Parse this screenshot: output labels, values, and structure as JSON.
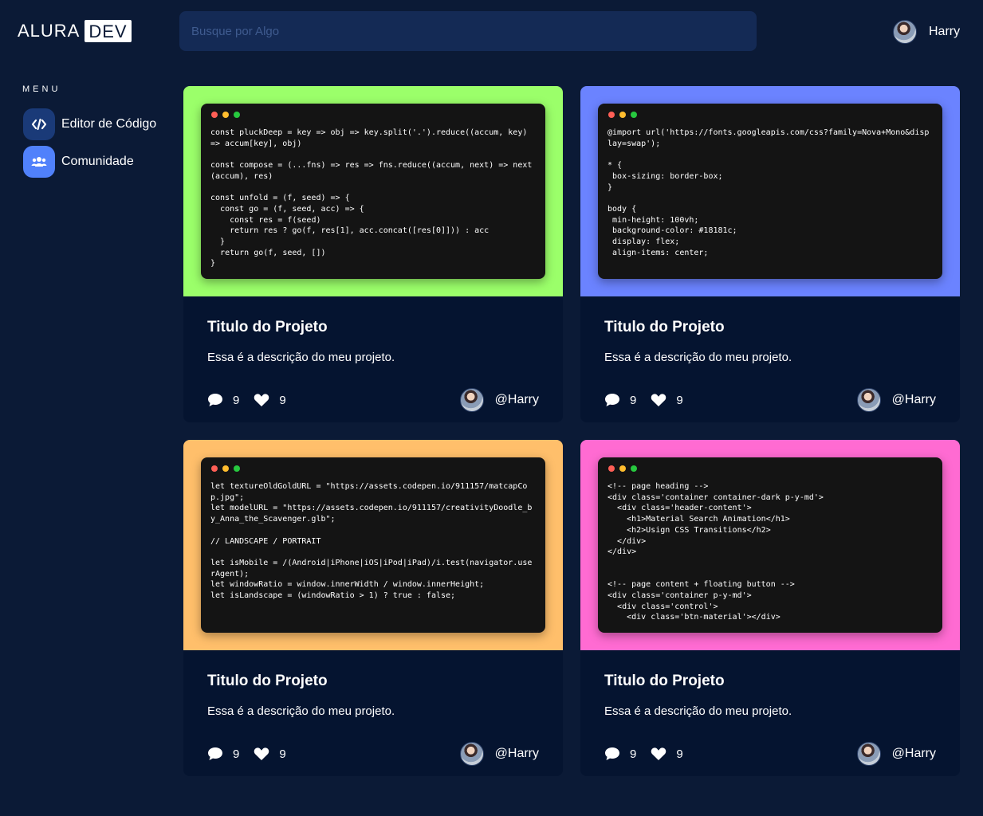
{
  "header": {
    "logo_text": "ALURA",
    "logo_badge": "DEV",
    "search_placeholder": "Busque por Algo",
    "user_name": "Harry"
  },
  "menu": {
    "title": "MENU",
    "items": [
      {
        "label": "Editor de Código",
        "icon": "code-icon"
      },
      {
        "label": "Comunidade",
        "icon": "users-icon"
      }
    ]
  },
  "colors": {
    "background": "#0b1a36",
    "card_green": "#9bff6a",
    "card_blue": "#6b83ff",
    "card_orange": "#ffbf6b",
    "card_pink": "#ff6bd2"
  },
  "cards": [
    {
      "color": "#9bff6a",
      "code": "const pluckDeep = key => obj => key.split('.').reduce((accum, key) => accum[key], obj)\n\nconst compose = (...fns) => res => fns.reduce((accum, next) => next(accum), res)\n\nconst unfold = (f, seed) => {\n  const go = (f, seed, acc) => {\n    const res = f(seed)\n    return res ? go(f, res[1], acc.concat([res[0]])) : acc\n  }\n  return go(f, seed, [])\n}",
      "title": "Titulo do Projeto",
      "description": "Essa é a descrição do meu projeto.",
      "comments": "9",
      "likes": "9",
      "author": "@Harry"
    },
    {
      "color": "#6b83ff",
      "code": "@import url('https://fonts.googleapis.com/css?family=Nova+Mono&display=swap');\n\n* {\n box-sizing: border-box;\n}\n\nbody {\n min-height: 100vh;\n background-color: #18181c;\n display: flex;\n align-items: center;",
      "title": "Titulo do Projeto",
      "description": "Essa é a descrição do meu projeto.",
      "comments": "9",
      "likes": "9",
      "author": "@Harry"
    },
    {
      "color": "#ffbf6b",
      "code": "let textureOldGoldURL = \"https://assets.codepen.io/911157/matcapCop.jpg\";\nlet modelURL = \"https://assets.codepen.io/911157/creativityDoodle_by_Anna_the_Scavenger.glb\";\n\n// LANDSCAPE / PORTRAIT\n\nlet isMobile = /(Android|iPhone|iOS|iPod|iPad)/i.test(navigator.userAgent);\nlet windowRatio = window.innerWidth / window.innerHeight;\nlet isLandscape = (windowRatio > 1) ? true : false;",
      "title": "Titulo do Projeto",
      "description": "Essa é a descrição do meu projeto.",
      "comments": "9",
      "likes": "9",
      "author": "@Harry"
    },
    {
      "color": "#ff6bd2",
      "code": "<!-- page heading -->\n<div class='container container-dark p-y-md'>\n  <div class='header-content'>\n    <h1>Material Search Animation</h1>\n    <h2>Usign CSS Transitions</h2>\n  </div>\n</div>\n\n\n<!-- page content + floating button -->\n<div class='container p-y-md'>\n  <div class='control'>\n    <div class='btn-material'></div>",
      "title": "Titulo do Projeto",
      "description": "Essa é a descrição do meu projeto.",
      "comments": "9",
      "likes": "9",
      "author": "@Harry"
    }
  ]
}
